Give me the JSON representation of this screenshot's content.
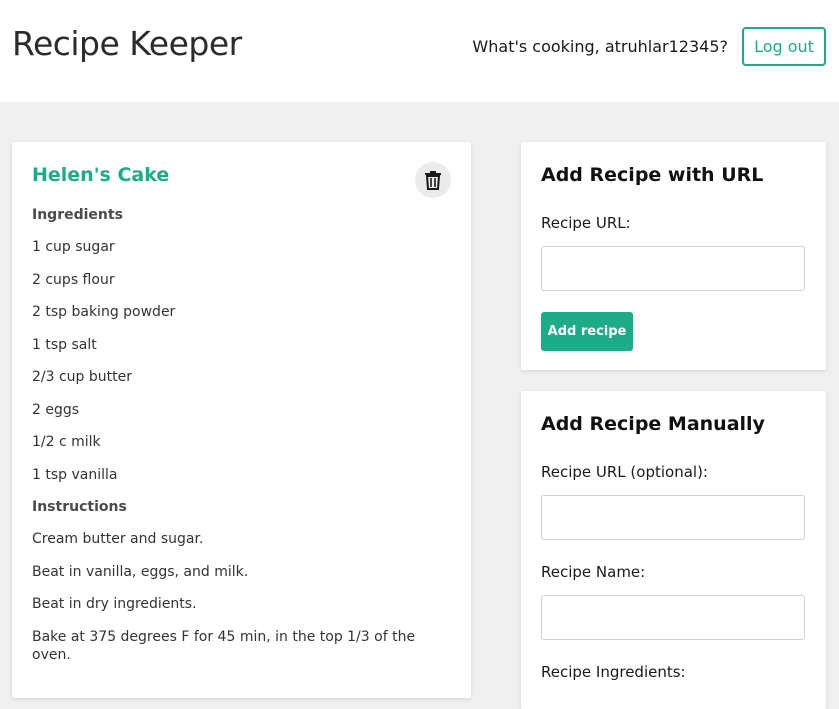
{
  "header": {
    "title": "Recipe Keeper",
    "greeting": "What's cooking, atruhlar12345?",
    "logout_label": "Log out"
  },
  "recipe": {
    "name": "Helen's Cake",
    "ingredients_heading": "Ingredients",
    "ingredients": [
      "1 cup sugar",
      "2 cups flour",
      "2 tsp baking powder",
      "1 tsp salt",
      "2/3 cup butter",
      "2 eggs",
      "1/2 c milk",
      "1 tsp vanilla"
    ],
    "instructions_heading": "Instructions",
    "instructions": [
      "Cream butter and sugar.",
      "Beat in vanilla, eggs, and milk.",
      "Beat in dry ingredients.",
      "Bake at 375 degrees F for 45 min, in the top 1/3 of the oven."
    ]
  },
  "add_url": {
    "title": "Add Recipe with URL",
    "url_label": "Recipe URL:",
    "url_value": "",
    "submit_label": "Add recipe"
  },
  "add_manual": {
    "title": "Add Recipe Manually",
    "url_label": "Recipe URL (optional):",
    "url_value": "",
    "name_label": "Recipe Name:",
    "name_value": "",
    "ingredients_label": "Recipe Ingredients:"
  },
  "colors": {
    "accent": "#1eab87",
    "background": "#f0f0f0"
  }
}
